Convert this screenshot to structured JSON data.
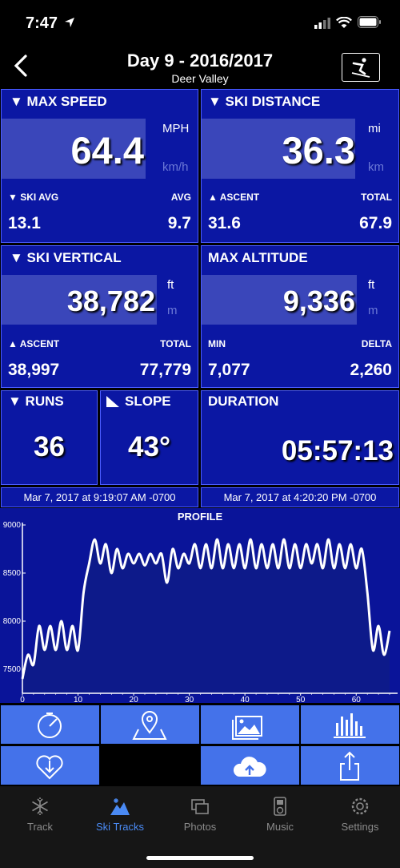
{
  "status": {
    "time": "7:47"
  },
  "header": {
    "title": "Day 9 - 2016/2017",
    "subtitle": "Deer Valley"
  },
  "max_speed": {
    "label": "▼ MAX SPEED",
    "value": "64.4",
    "unit_primary": "MPH",
    "unit_secondary": "km/h",
    "left_label": "▼ SKI AVG",
    "right_label": "AVG",
    "left_value": "13.1",
    "right_value": "9.7"
  },
  "ski_distance": {
    "label": "▼ SKI DISTANCE",
    "value": "36.3",
    "unit_primary": "mi",
    "unit_secondary": "km",
    "left_label": "▲ ASCENT",
    "right_label": "TOTAL",
    "left_value": "31.6",
    "right_value": "67.9"
  },
  "ski_vertical": {
    "label": "▼ SKI VERTICAL",
    "value": "38,782",
    "unit_primary": "ft",
    "unit_secondary": "m",
    "left_label": "▲ ASCENT",
    "right_label": "TOTAL",
    "left_value": "38,997",
    "right_value": "77,779"
  },
  "max_altitude": {
    "label": "MAX ALTITUDE",
    "value": "9,336",
    "unit_primary": "ft",
    "unit_secondary": "m",
    "left_label": "MIN",
    "right_label": "DELTA",
    "left_value": "7,077",
    "right_value": "2,260"
  },
  "runs": {
    "label": "▼ RUNS",
    "value": "36"
  },
  "slope": {
    "label": "SLOPE",
    "value": "43°"
  },
  "duration": {
    "label": "DURATION",
    "value": "05:57:13"
  },
  "dates": {
    "start": "Mar 7, 2017 at 9:19:07 AM -0700",
    "end": "Mar 7, 2017 at 4:20:20 PM -0700"
  },
  "chart_data": {
    "type": "line",
    "title": "PROFILE",
    "xlim": [
      0,
      66
    ],
    "ylim": [
      7250,
      9000
    ],
    "xticks": [
      "0",
      "10",
      "20",
      "30",
      "40",
      "50",
      "60"
    ],
    "yticks": [
      "9000",
      "8500",
      "8000",
      "7500"
    ],
    "x": [
      0,
      1,
      2,
      3,
      4,
      5,
      6,
      7,
      8,
      9,
      10,
      11,
      12,
      13,
      14,
      15,
      16,
      17,
      18,
      19,
      20,
      21,
      22,
      23,
      24,
      25,
      26,
      27,
      28,
      29,
      30,
      31,
      32,
      33,
      34,
      35,
      36,
      37,
      38,
      39,
      40,
      41,
      42,
      43,
      44,
      45,
      46,
      47,
      48,
      49,
      50,
      51,
      52,
      53,
      54,
      55,
      56,
      57,
      58,
      59,
      60,
      61,
      62,
      63,
      64,
      65,
      66
    ],
    "y": [
      7400,
      7650,
      7550,
      7950,
      7700,
      7950,
      7700,
      8000,
      7700,
      7950,
      7700,
      8300,
      8600,
      8850,
      8600,
      8800,
      8500,
      8750,
      8550,
      8700,
      8600,
      8700,
      8580,
      8700,
      8600,
      8700,
      8400,
      8750,
      8550,
      8700,
      8600,
      8800,
      8550,
      8800,
      8550,
      8850,
      8550,
      8800,
      8550,
      8800,
      8550,
      8850,
      8550,
      8800,
      8550,
      8800,
      8550,
      8850,
      8550,
      8800,
      8550,
      8800,
      8600,
      8800,
      8550,
      8850,
      8550,
      8800,
      8550,
      8800,
      8550,
      8750,
      8300,
      7700,
      7950,
      7650,
      7900
    ]
  },
  "tabs": [
    {
      "label": "Track",
      "icon": "snowflake-icon"
    },
    {
      "label": "Ski Tracks",
      "icon": "mountain-snow-icon"
    },
    {
      "label": "Photos",
      "icon": "photos-icon"
    },
    {
      "label": "Music",
      "icon": "music-player-icon"
    },
    {
      "label": "Settings",
      "icon": "gear-icon"
    }
  ],
  "colors": {
    "tile": "#0b17a3",
    "button": "#4472ea",
    "accent": "#4a8af4"
  }
}
